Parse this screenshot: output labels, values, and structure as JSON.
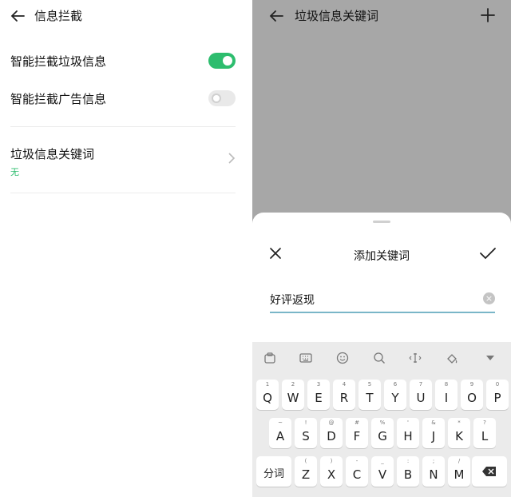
{
  "left": {
    "title": "信息拦截",
    "rows": [
      {
        "label": "智能拦截垃圾信息",
        "toggle": "on"
      },
      {
        "label": "智能拦截广告信息",
        "toggle": "off"
      }
    ],
    "keywords": {
      "label": "垃圾信息关键词",
      "value": "无"
    }
  },
  "right": {
    "title": "垃圾信息关键词",
    "sheet": {
      "title": "添加关键词",
      "input_value": "好评返现"
    },
    "keyboard": {
      "row1": [
        {
          "sup": "1",
          "ch": "Q"
        },
        {
          "sup": "2",
          "ch": "W"
        },
        {
          "sup": "3",
          "ch": "E"
        },
        {
          "sup": "4",
          "ch": "R"
        },
        {
          "sup": "5",
          "ch": "T"
        },
        {
          "sup": "6",
          "ch": "Y"
        },
        {
          "sup": "7",
          "ch": "U"
        },
        {
          "sup": "8",
          "ch": "I"
        },
        {
          "sup": "9",
          "ch": "O"
        },
        {
          "sup": "0",
          "ch": "P"
        }
      ],
      "row2": [
        {
          "sup": "~",
          "ch": "A"
        },
        {
          "sup": "!",
          "ch": "S"
        },
        {
          "sup": "@",
          "ch": "D"
        },
        {
          "sup": "#",
          "ch": "F"
        },
        {
          "sup": "%",
          "ch": "G"
        },
        {
          "sup": "'",
          "ch": "H"
        },
        {
          "sup": "&",
          "ch": "J"
        },
        {
          "sup": "*",
          "ch": "K"
        },
        {
          "sup": "?",
          "ch": "L"
        }
      ],
      "fenci": "分词",
      "row3": [
        {
          "sup": "(",
          "ch": "Z"
        },
        {
          "sup": ")",
          "ch": "X"
        },
        {
          "sup": "-",
          "ch": "C"
        },
        {
          "sup": "_",
          "ch": "V"
        },
        {
          "sup": ":",
          "ch": "B"
        },
        {
          "sup": ";",
          "ch": "N"
        },
        {
          "sup": "/",
          "ch": "M"
        }
      ]
    }
  },
  "colors": {
    "accent": "#2dbd6e",
    "overlay": "#a7a7a7"
  }
}
